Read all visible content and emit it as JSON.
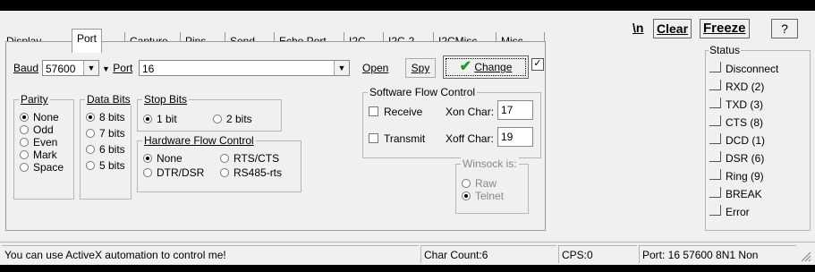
{
  "tabs": [
    "Display",
    "Port",
    "Capture",
    "Pins",
    "Send",
    "Echo Port",
    "I2C",
    "I2C-2",
    "I2CMisc",
    "Misc"
  ],
  "toolbar": {
    "newline": "\\n",
    "clear": "Clear",
    "freeze": "Freeze",
    "help": "?"
  },
  "port": {
    "baud_label": "Baud",
    "baud_value": "57600",
    "port_label": "Port",
    "port_value": "16",
    "open": "Open",
    "spy": "Spy",
    "change": "Change",
    "parity": {
      "title": "Parity",
      "options": [
        "None",
        "Odd",
        "Even",
        "Mark",
        "Space"
      ],
      "selected": "None"
    },
    "databits": {
      "title": "Data Bits",
      "options": [
        "8 bits",
        "7 bits",
        "6 bits",
        "5 bits"
      ],
      "selected": "8 bits"
    },
    "stopbits": {
      "title": "Stop Bits",
      "options": [
        "1 bit",
        "2 bits"
      ],
      "selected": "1 bit"
    },
    "hwflow": {
      "title": "Hardware Flow Control",
      "options": [
        "None",
        "RTS/CTS",
        "DTR/DSR",
        "RS485-rts"
      ],
      "selected": "None"
    },
    "swflow": {
      "title": "Software Flow Control",
      "receive": "Receive",
      "transmit": "Transmit",
      "xon_label": "Xon Char:",
      "xon_value": "17",
      "xoff_label": "Xoff Char:",
      "xoff_value": "19"
    },
    "winsock": {
      "title": "Winsock is:",
      "options": [
        "Raw",
        "Telnet"
      ],
      "selected": "Telnet"
    }
  },
  "status": {
    "title": "Status",
    "items": [
      "Disconnect",
      "RXD (2)",
      "TXD (3)",
      "CTS (8)",
      "DCD (1)",
      "DSR (6)",
      "Ring (9)",
      "BREAK",
      "Error"
    ]
  },
  "statusbar": {
    "message": "You can use ActiveX automation to control me!",
    "char_count": "Char Count:6",
    "cps": "CPS:0",
    "port_info": "Port: 16 57600 8N1 Non"
  },
  "colors": {
    "check": "#1a9a1a",
    "panel_bg": "#f0f0f0"
  }
}
